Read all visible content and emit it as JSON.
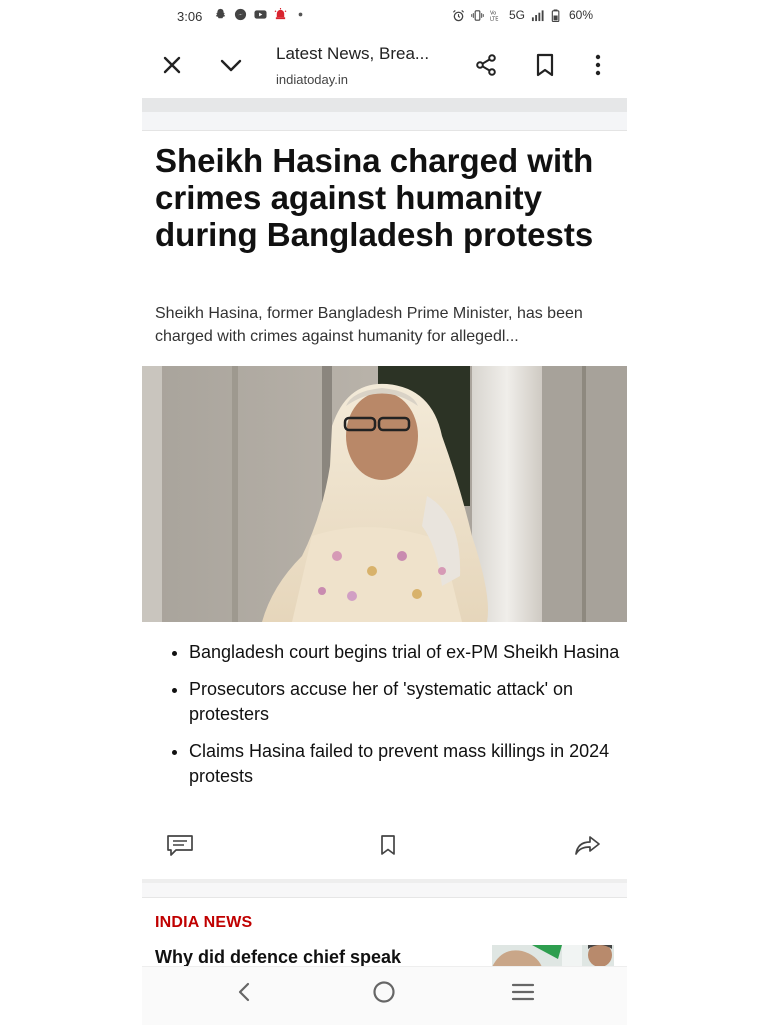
{
  "status_bar": {
    "time": "3:06",
    "network": "5G",
    "battery": "60%"
  },
  "toolbar": {
    "title": "Latest News, Brea...",
    "url": "indiatoday.in"
  },
  "article": {
    "headline": "Sheikh Hasina charged with crimes against humanity during Bangladesh protests",
    "summary": "Sheikh Hasina, former Bangladesh Prime Minister, has been charged with crimes against humanity for allegedl...",
    "highlights": [
      "Bangladesh court begins trial of ex-PM Sheikh Hasina",
      "Prosecutors accuse her of 'systematic attack' on protesters",
      "Claims Hasina failed to prevent mass killings in 2024 protests"
    ]
  },
  "next_story": {
    "category": "INDIA NEWS",
    "headline": "Why did defence chief speak"
  },
  "colors": {
    "accent_red": "#c00000",
    "separator": "#e6e7e8"
  }
}
